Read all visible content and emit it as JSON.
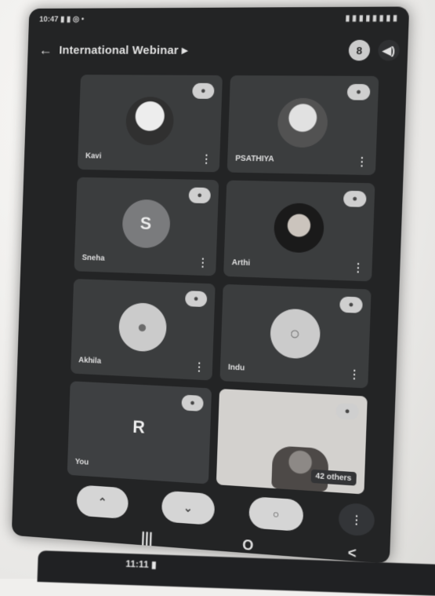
{
  "status_bar": {
    "left": "10:47 ▮ ▮ ◎ •",
    "right": "▮ ▮ ▮ ▮ ▮ ▮ ▮ ▮"
  },
  "header": {
    "back_icon": "←",
    "title": "International Webinar ▸",
    "participant_count": "8",
    "speaker_icon": "◀)"
  },
  "tiles": [
    {
      "name": "Kavi",
      "avatar_letter": "",
      "mic_icon": "mic-off-icon"
    },
    {
      "name": "PSATHIYA",
      "avatar_letter": "",
      "mic_icon": "mic-off-icon"
    },
    {
      "name": "Sneha",
      "avatar_letter": "S",
      "mic_icon": "mic-off-icon"
    },
    {
      "name": "Arthi",
      "avatar_letter": "",
      "mic_icon": "mic-off-icon"
    },
    {
      "name": "Akhila",
      "avatar_letter": "",
      "mic_icon": "mic-off-icon"
    },
    {
      "name": "Indu",
      "avatar_letter": "",
      "mic_icon": "mic-off-icon"
    },
    {
      "name": "You",
      "avatar_letter": "R",
      "mic_icon": "mic-off-icon"
    },
    {
      "name": "",
      "others_label": "42 others",
      "mic_icon": "mic-off-icon"
    }
  ],
  "more_label": "⋮",
  "controls": {
    "end_call": "⌃",
    "mic": "⌄",
    "camera": "○",
    "more": "⋮"
  },
  "navbar": {
    "recents": "|||",
    "home": "O",
    "back": "<"
  },
  "bottom_phone_text": "11:11 ▮"
}
